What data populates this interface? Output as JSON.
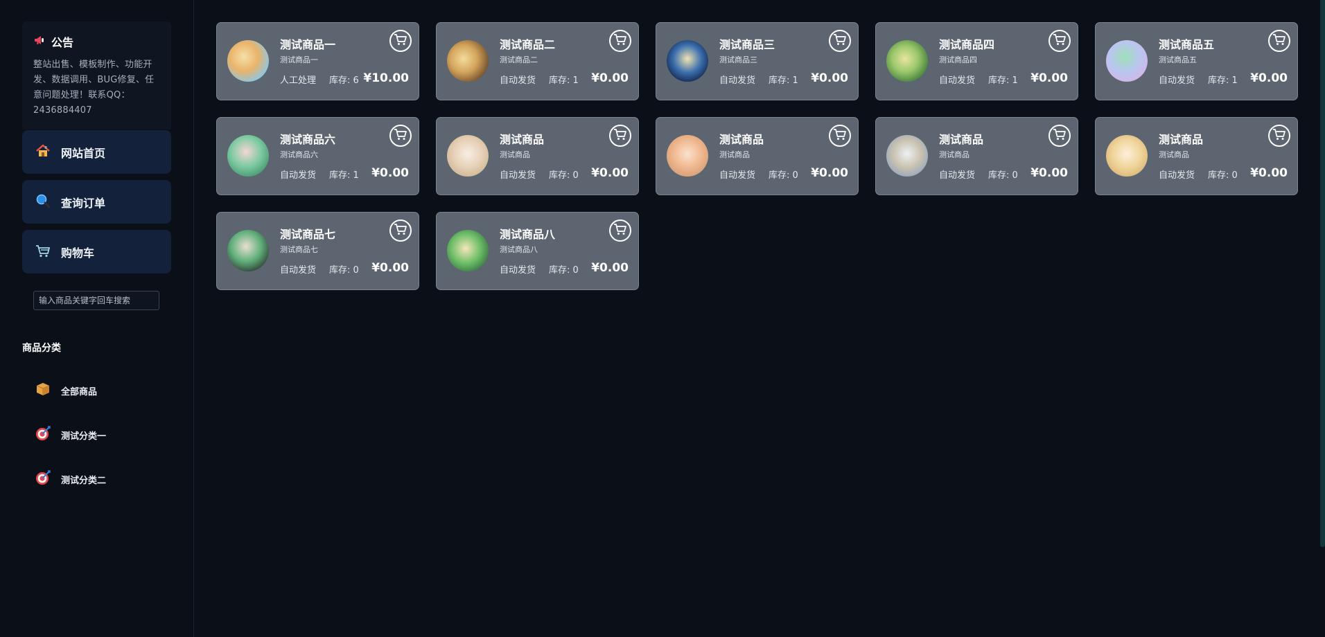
{
  "notice": {
    "title": "公告",
    "icon": "megaphone-icon",
    "text": "整站出售、模板制作、功能开发、数据调用、BUG修复、任意问题处理！联系QQ：2436884407"
  },
  "nav": [
    {
      "label": "网站首页",
      "icon": "house-icon"
    },
    {
      "label": "查询订单",
      "icon": "magnifier-icon"
    },
    {
      "label": "购物车",
      "icon": "cart-icon"
    }
  ],
  "search": {
    "placeholder": "输入商品关键字回车搜索",
    "value": ""
  },
  "categories": {
    "title": "商品分类",
    "items": [
      {
        "label": "全部商品",
        "icon": "package-icon"
      },
      {
        "label": "测试分类一",
        "icon": "dart-target-icon"
      },
      {
        "label": "测试分类二",
        "icon": "dart-target-icon"
      }
    ]
  },
  "products": [
    {
      "name": "测试商品一",
      "sub": "测试商品一",
      "ship": "人工处理",
      "stock": "库存: 6",
      "price": "¥10.00"
    },
    {
      "name": "测试商品二",
      "sub": "测试商品二",
      "ship": "自动发货",
      "stock": "库存: 1",
      "price": "¥0.00"
    },
    {
      "name": "测试商品三",
      "sub": "测试商品三",
      "ship": "自动发货",
      "stock": "库存: 1",
      "price": "¥0.00"
    },
    {
      "name": "测试商品四",
      "sub": "测试商品四",
      "ship": "自动发货",
      "stock": "库存: 1",
      "price": "¥0.00"
    },
    {
      "name": "测试商品五",
      "sub": "测试商品五",
      "ship": "自动发货",
      "stock": "库存: 1",
      "price": "¥0.00"
    },
    {
      "name": "测试商品六",
      "sub": "测试商品六",
      "ship": "自动发货",
      "stock": "库存: 1",
      "price": "¥0.00"
    },
    {
      "name": "测试商品",
      "sub": "测试商品",
      "ship": "自动发货",
      "stock": "库存: 0",
      "price": "¥0.00"
    },
    {
      "name": "测试商品",
      "sub": "测试商品",
      "ship": "自动发货",
      "stock": "库存: 0",
      "price": "¥0.00"
    },
    {
      "name": "测试商品",
      "sub": "测试商品",
      "ship": "自动发货",
      "stock": "库存: 0",
      "price": "¥0.00"
    },
    {
      "name": "测试商品",
      "sub": "测试商品",
      "ship": "自动发货",
      "stock": "库存: 0",
      "price": "¥0.00"
    },
    {
      "name": "测试商品七",
      "sub": "测试商品七",
      "ship": "自动发货",
      "stock": "库存: 0",
      "price": "¥0.00"
    },
    {
      "name": "测试商品八",
      "sub": "测试商品八",
      "ship": "自动发货",
      "stock": "库存: 0",
      "price": "¥0.00"
    }
  ],
  "colors": {
    "background": "#0b0f17",
    "card": "#5c6570",
    "nav_button": "#14213a"
  }
}
